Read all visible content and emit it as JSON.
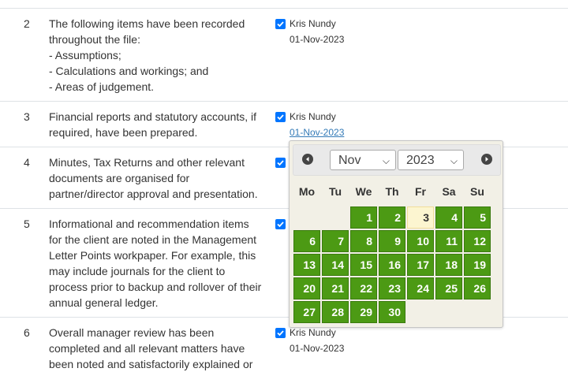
{
  "rows": [
    {
      "num": "2",
      "desc": [
        "The following items have been recorded",
        "throughout the file:",
        "- Assumptions;",
        "- Calculations and workings; and",
        "- Areas of judgement."
      ],
      "signer": "Kris Nundy",
      "date": "01-Nov-2023"
    },
    {
      "num": "3",
      "desc": [
        "Financial reports and statutory accounts, if",
        "required, have been prepared."
      ],
      "signer": "Kris Nundy",
      "date": "01-Nov-2023"
    },
    {
      "num": "4",
      "desc": [
        "Minutes, Tax Returns and other relevant",
        "documents are organised for",
        "partner/director approval and presentation."
      ]
    },
    {
      "num": "5",
      "desc": [
        "Informational and recommendation items",
        "for the client are noted in the Management",
        "Letter Points workpaper. For example, this",
        "may include journals for the client to",
        "process prior to backup and rollover of their",
        "annual general ledger."
      ]
    },
    {
      "num": "6",
      "desc": [
        "Overall manager review has been",
        "completed and all relevant matters have",
        "been noted and satisfactorily explained or"
      ],
      "signer": "Kris Nundy",
      "date": "01-Nov-2023"
    }
  ],
  "datepicker": {
    "month": "Nov",
    "year": "2023",
    "weekdays": [
      "Mo",
      "Tu",
      "We",
      "Th",
      "Fr",
      "Sa",
      "Su"
    ],
    "days": [
      "1",
      "2",
      "3",
      "4",
      "5",
      "6",
      "7",
      "8",
      "9",
      "10",
      "11",
      "12",
      "13",
      "14",
      "15",
      "16",
      "17",
      "18",
      "19",
      "20",
      "21",
      "22",
      "23",
      "24",
      "25",
      "26",
      "27",
      "28",
      "29",
      "30"
    ],
    "today": "3",
    "colors": {
      "day_bg": "#4c9a14",
      "today_bg": "#fcf5d0",
      "checkbox": "#0075ff",
      "link": "#337ab7"
    }
  }
}
